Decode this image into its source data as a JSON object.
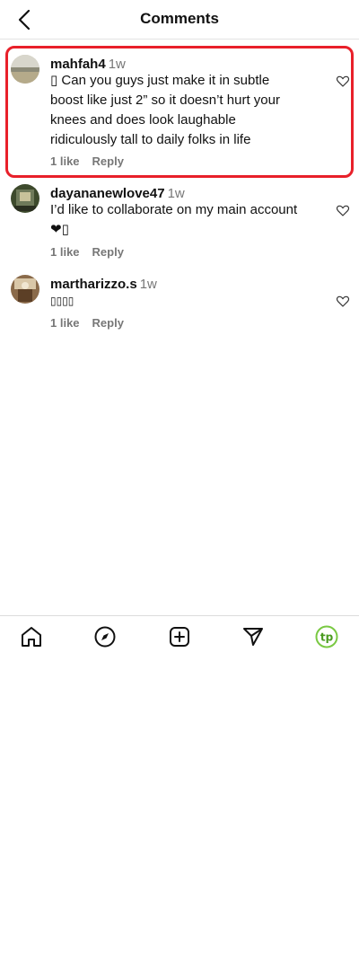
{
  "header": {
    "title": "Comments"
  },
  "comments": [
    {
      "username": "mahfah4",
      "time": "1w",
      "text": "▯ Can you guys just make it in subtle boost like just 2” so it doesn’t hurt your knees and does look laughable ridiculously tall to daily folks in life",
      "likes_label": "1 like",
      "reply_label": "Reply"
    },
    {
      "username": "dayananewlove47",
      "time": "1w",
      "text": "I’d like to collaborate on my main account ❤▯",
      "likes_label": "1 like",
      "reply_label": "Reply"
    },
    {
      "username": "martharizzo.s",
      "time": "1w",
      "text": "▯▯▯▯",
      "likes_label": "1 like",
      "reply_label": "Reply"
    }
  ],
  "tabbar": {
    "items": [
      "home-icon",
      "explore-icon",
      "create-icon",
      "send-icon",
      "profile-avatar"
    ],
    "profile_initials": "tp",
    "accent_color": "#7ac943"
  },
  "colors": {
    "highlight_border": "#e8202a",
    "muted_text": "#777777"
  }
}
